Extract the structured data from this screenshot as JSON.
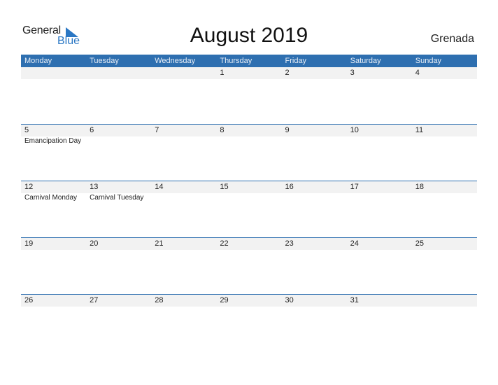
{
  "logo": {
    "general": "General",
    "blue": "Blue"
  },
  "title": "August 2019",
  "country": "Grenada",
  "weekdays": [
    "Monday",
    "Tuesday",
    "Wednesday",
    "Thursday",
    "Friday",
    "Saturday",
    "Sunday"
  ],
  "weeks": [
    [
      {
        "day": "",
        "holiday": ""
      },
      {
        "day": "",
        "holiday": ""
      },
      {
        "day": "",
        "holiday": ""
      },
      {
        "day": "1",
        "holiday": ""
      },
      {
        "day": "2",
        "holiday": ""
      },
      {
        "day": "3",
        "holiday": ""
      },
      {
        "day": "4",
        "holiday": ""
      }
    ],
    [
      {
        "day": "5",
        "holiday": "Emancipation Day"
      },
      {
        "day": "6",
        "holiday": ""
      },
      {
        "day": "7",
        "holiday": ""
      },
      {
        "day": "8",
        "holiday": ""
      },
      {
        "day": "9",
        "holiday": ""
      },
      {
        "day": "10",
        "holiday": ""
      },
      {
        "day": "11",
        "holiday": ""
      }
    ],
    [
      {
        "day": "12",
        "holiday": "Carnival Monday"
      },
      {
        "day": "13",
        "holiday": "Carnival Tuesday"
      },
      {
        "day": "14",
        "holiday": ""
      },
      {
        "day": "15",
        "holiday": ""
      },
      {
        "day": "16",
        "holiday": ""
      },
      {
        "day": "17",
        "holiday": ""
      },
      {
        "day": "18",
        "holiday": ""
      }
    ],
    [
      {
        "day": "19",
        "holiday": ""
      },
      {
        "day": "20",
        "holiday": ""
      },
      {
        "day": "21",
        "holiday": ""
      },
      {
        "day": "22",
        "holiday": ""
      },
      {
        "day": "23",
        "holiday": ""
      },
      {
        "day": "24",
        "holiday": ""
      },
      {
        "day": "25",
        "holiday": ""
      }
    ],
    [
      {
        "day": "26",
        "holiday": ""
      },
      {
        "day": "27",
        "holiday": ""
      },
      {
        "day": "28",
        "holiday": ""
      },
      {
        "day": "29",
        "holiday": ""
      },
      {
        "day": "30",
        "holiday": ""
      },
      {
        "day": "31",
        "holiday": ""
      },
      {
        "day": "",
        "holiday": ""
      }
    ]
  ]
}
